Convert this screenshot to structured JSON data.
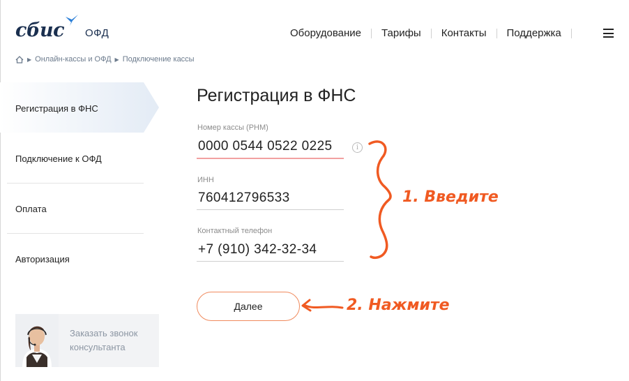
{
  "brand": {
    "logo_text": "сбис",
    "sub": "ОФД"
  },
  "topnav": [
    "Оборудование",
    "Тарифы",
    "Контакты",
    "Поддержка"
  ],
  "breadcrumb": [
    "Онлайн-кассы и ОФД",
    "Подключение кассы"
  ],
  "sidebar": {
    "items": [
      "Регистрация в ФНС",
      "Подключение к ОФД",
      "Оплата",
      "Авторизация"
    ],
    "active_index": 0,
    "callback": "Заказать звонок консультанта"
  },
  "form": {
    "title": "Регистрация в ФНС",
    "fields": [
      {
        "label": "Номер кассы (РНМ)",
        "value": "0000 0544 0522 0225"
      },
      {
        "label": "ИНН",
        "value": "760412796533"
      },
      {
        "label": "Контактный телефон",
        "value": "+7 (910) 342-32-34"
      }
    ],
    "submit_label": "Далее"
  },
  "annotations": {
    "step1": "1. Введите",
    "step2": "2. Нажмите"
  },
  "colors": {
    "accent": "#f05a22",
    "brand": "#1a2f4f",
    "button_border": "#f08a5d",
    "active_bg": "#e8eef6"
  }
}
